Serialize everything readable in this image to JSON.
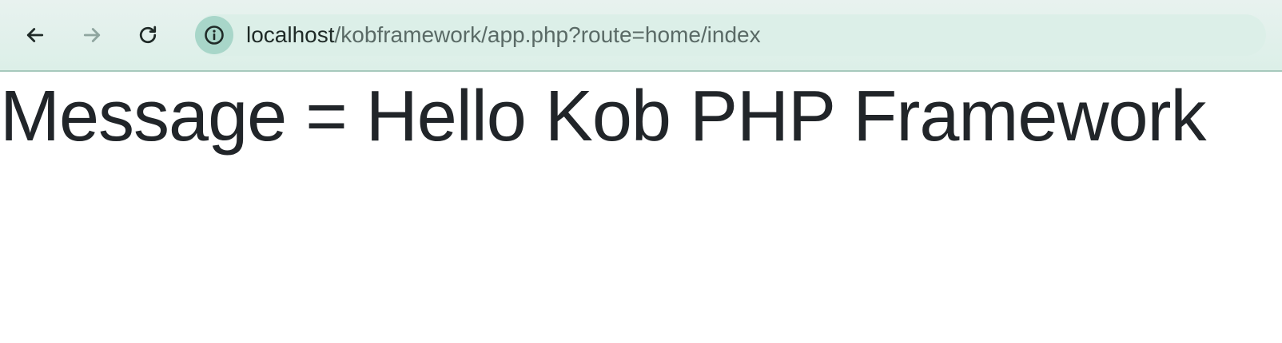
{
  "browser": {
    "url_host": "localhost",
    "url_path": "/kobframework/app.php?route=home/index",
    "back_icon": "arrow-left-icon",
    "forward_icon": "arrow-right-icon",
    "reload_icon": "reload-icon",
    "site_info_icon": "info-icon",
    "colors": {
      "toolbar_bg": "#dcefe8",
      "site_info_bg": "#a8d6c9",
      "forward_disabled": "#8fa59f",
      "icon_active": "#1f2a27"
    }
  },
  "page": {
    "heading": "Message = Hello Kob PHP Framework",
    "text_color": "#212529"
  }
}
